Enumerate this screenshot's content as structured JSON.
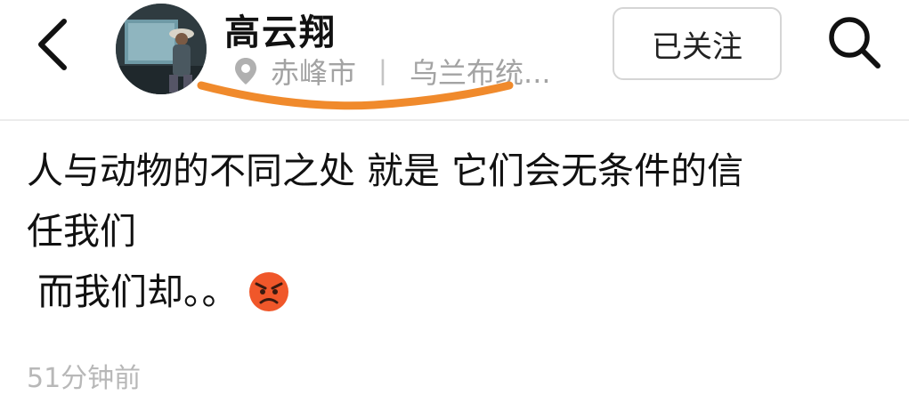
{
  "header": {
    "user_name": "高云翔",
    "location": {
      "city": "赤峰市",
      "separator": "丨",
      "detail": "乌兰布统..."
    },
    "follow_label": "已关注",
    "underline_color": "#f08a2c"
  },
  "post": {
    "lines": [
      "人与动物的不同之处 就是 它们会无条件的信",
      "任我们",
      "而我们却。。"
    ],
    "emoji": "angry-face-icon"
  },
  "timestamp": "51分钟前"
}
